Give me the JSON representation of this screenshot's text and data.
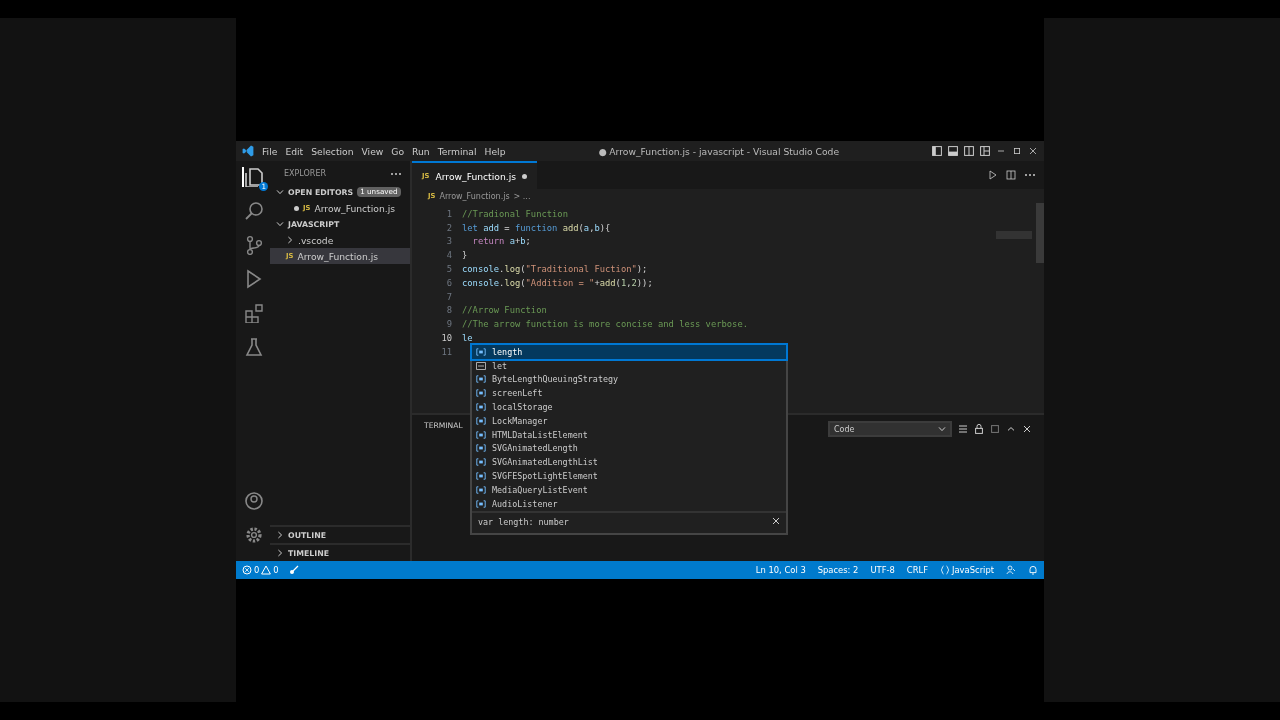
{
  "window": {
    "title": "● Arrow_Function.js - javascript - Visual Studio Code",
    "menu": [
      "File",
      "Edit",
      "Selection",
      "View",
      "Go",
      "Run",
      "Terminal",
      "Help"
    ]
  },
  "activity_bar": {
    "items": [
      {
        "kind": "files",
        "selected": true,
        "badge": "1"
      },
      {
        "kind": "search",
        "selected": false
      },
      {
        "kind": "branch",
        "selected": false
      },
      {
        "kind": "run",
        "selected": false
      },
      {
        "kind": "extensions",
        "selected": false
      },
      {
        "kind": "flask",
        "selected": false
      }
    ],
    "bottom": [
      {
        "kind": "account"
      },
      {
        "kind": "gear"
      }
    ]
  },
  "sidebar": {
    "title": "EXPLORER",
    "open_editors": {
      "title": "OPEN EDITORS",
      "expanded": true,
      "badge": "1 unsaved",
      "items": [
        {
          "name": "Arrow_Function.js",
          "icon": "JS",
          "unsaved": true
        }
      ]
    },
    "workspace": {
      "title": "JAVASCRIPT",
      "expanded": true,
      "children": [
        {
          "name": ".vscode",
          "kind": "folder",
          "expanded": false
        },
        {
          "name": "Arrow_Function.js",
          "kind": "file",
          "icon": "JS",
          "selected": true
        }
      ]
    },
    "sections": [
      {
        "title": "OUTLINE",
        "expanded": false
      },
      {
        "title": "TIMELINE",
        "expanded": false
      }
    ]
  },
  "editor": {
    "tabs": [
      {
        "label": "Arrow_Function.js",
        "icon": "JS",
        "selected": true,
        "unsaved": true
      }
    ],
    "breadcrumb": {
      "icon": "JS",
      "file": "Arrow_Function.js",
      "rest": "> ..."
    },
    "lines": [
      {
        "number": "1",
        "current": false,
        "tokens": [
          {
            "kind": "comment",
            "text": "//Tradional Function"
          }
        ]
      },
      {
        "number": "2",
        "current": false,
        "tokens": [
          {
            "kind": "keyword",
            "text": "let"
          },
          {
            "kind": "variable",
            "text": " add"
          },
          {
            "kind": "plain",
            "text": " = "
          },
          {
            "kind": "keyword",
            "text": "function"
          },
          {
            "kind": "function",
            "text": " add"
          },
          {
            "kind": "plain",
            "text": "("
          },
          {
            "kind": "variable",
            "text": "a"
          },
          {
            "kind": "plain",
            "text": ","
          },
          {
            "kind": "variable",
            "text": "b"
          },
          {
            "kind": "plain",
            "text": "){"
          }
        ]
      },
      {
        "number": "3",
        "current": false,
        "tokens": [
          {
            "kind": "control",
            "text": "  return"
          },
          {
            "kind": "variable",
            "text": " a"
          },
          {
            "kind": "plain",
            "text": "+"
          },
          {
            "kind": "variable",
            "text": "b"
          },
          {
            "kind": "plain",
            "text": ";"
          }
        ]
      },
      {
        "number": "4",
        "current": false,
        "tokens": [
          {
            "kind": "plain",
            "text": "}"
          }
        ]
      },
      {
        "number": "5",
        "current": false,
        "tokens": [
          {
            "kind": "variable",
            "text": "console"
          },
          {
            "kind": "plain",
            "text": "."
          },
          {
            "kind": "function",
            "text": "log"
          },
          {
            "kind": "plain",
            "text": "("
          },
          {
            "kind": "string",
            "text": "\"Traditional Fuction\""
          },
          {
            "kind": "plain",
            "text": ");"
          }
        ]
      },
      {
        "number": "6",
        "current": false,
        "tokens": [
          {
            "kind": "variable",
            "text": "console"
          },
          {
            "kind": "plain",
            "text": "."
          },
          {
            "kind": "function",
            "text": "log"
          },
          {
            "kind": "plain",
            "text": "("
          },
          {
            "kind": "string",
            "text": "\"Addition = \""
          },
          {
            "kind": "plain",
            "text": "+"
          },
          {
            "kind": "function",
            "text": "add"
          },
          {
            "kind": "plain",
            "text": "("
          },
          {
            "kind": "number",
            "text": "1"
          },
          {
            "kind": "plain",
            "text": ","
          },
          {
            "kind": "number",
            "text": "2"
          },
          {
            "kind": "plain",
            "text": "));"
          }
        ]
      },
      {
        "number": "7",
        "current": false
      },
      {
        "number": "8",
        "current": false,
        "tokens": [
          {
            "kind": "comment",
            "text": "//Arrow Function"
          }
        ]
      },
      {
        "number": "9",
        "current": false,
        "tokens": [
          {
            "kind": "comment",
            "text": "//The arrow function is more concise and less verbose."
          }
        ]
      },
      {
        "number": "10",
        "current": true,
        "tokens": [
          {
            "kind": "variable",
            "text": "le"
          }
        ]
      },
      {
        "number": "11",
        "current": false
      }
    ],
    "suggest": {
      "items": [
        {
          "label": "length",
          "kind": "variable",
          "selected": true
        },
        {
          "label": "let",
          "kind": "keyword",
          "selected": false
        },
        {
          "label": "ByteLengthQueuingStrategy",
          "kind": "variable",
          "selected": false
        },
        {
          "label": "screenLeft",
          "kind": "variable",
          "selected": false
        },
        {
          "label": "localStorage",
          "kind": "variable",
          "selected": false
        },
        {
          "label": "LockManager",
          "kind": "variable",
          "selected": false
        },
        {
          "label": "HTMLDataListElement",
          "kind": "variable",
          "selected": false
        },
        {
          "label": "SVGAnimatedLength",
          "kind": "variable",
          "selected": false
        },
        {
          "label": "SVGAnimatedLengthList",
          "kind": "variable",
          "selected": false
        },
        {
          "label": "SVGFESpotLightElement",
          "kind": "variable",
          "selected": false
        },
        {
          "label": "MediaQueryListEvent",
          "kind": "variable",
          "selected": false
        },
        {
          "label": "AudioListener",
          "kind": "variable",
          "selected": false
        }
      ],
      "detail": "var length: number"
    }
  },
  "panel": {
    "tabs": [
      {
        "label": "TERMINAL",
        "selected": true
      }
    ],
    "terminal_select": "Code"
  },
  "status_bar": {
    "errors": "0",
    "warnings": "0",
    "position": "Ln 10, Col 3",
    "indent": "Spaces: 2",
    "encoding": "UTF-8",
    "eol": "CRLF",
    "language": "JavaScript"
  }
}
